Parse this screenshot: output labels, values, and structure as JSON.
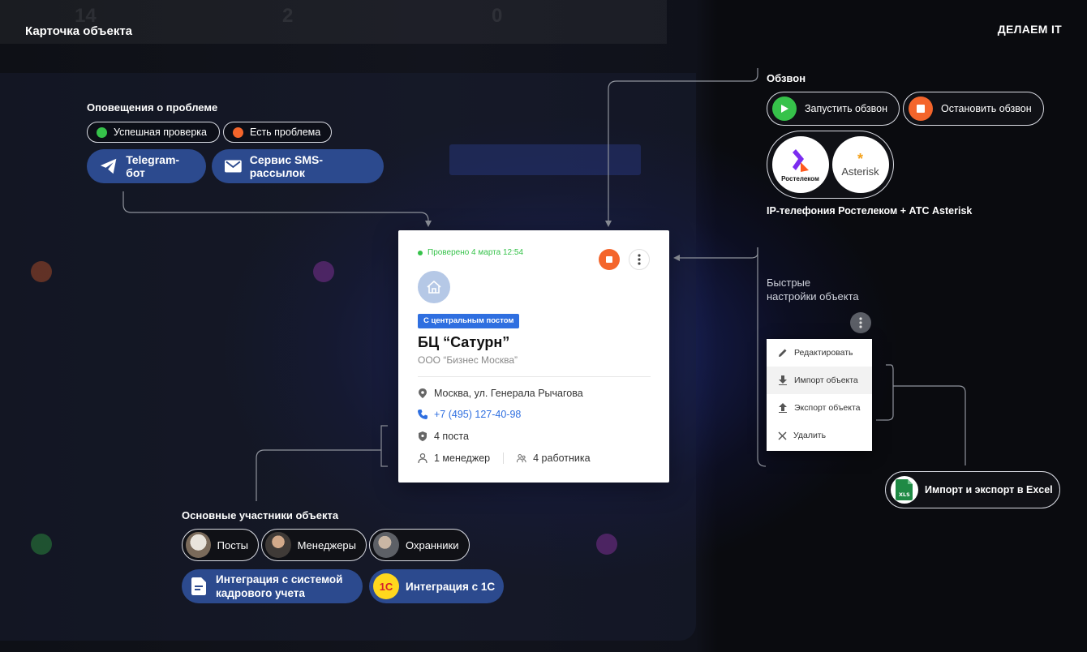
{
  "header": {
    "title": "Карточка объекта",
    "brand": "ДЕЛАЕМ IT"
  },
  "notifications": {
    "label": "Оповещения о проблеме",
    "statuses": [
      {
        "label": "Успешная проверка",
        "color": "#36c24a"
      },
      {
        "label": "Есть проблема",
        "color": "#f4652b"
      }
    ],
    "channels": [
      {
        "label": "Telegram-бот",
        "icon": "telegram-icon"
      },
      {
        "label": "Сервис SMS-рассылок",
        "icon": "mail-icon"
      }
    ]
  },
  "calling": {
    "label": "Обзвон",
    "start": "Запустить обзвон",
    "stop": "Остановить обзвон",
    "logos": [
      "Ростелеком",
      "Asterisk"
    ],
    "caption": "IP-телефония Ростелеком + АТС Asterisk"
  },
  "card": {
    "checked": "Проверено 4 марта 12:54",
    "tag": "С центральным постом",
    "name": "БЦ “Сатурн”",
    "org": "ООО “Бизнес Москва”",
    "address": "Москва, ул. Генерала Рычагова",
    "phone": "+7 (495) 127-40-98",
    "posts": "4 поста",
    "managers": "1 менеджер",
    "workers": "4 работника"
  },
  "quick_settings": {
    "label_line1": "Быстрые",
    "label_line2": "настройки объекта",
    "menu": [
      {
        "label": "Редактировать",
        "icon": "pencil-icon"
      },
      {
        "label": "Импорт объекта",
        "icon": "download-icon"
      },
      {
        "label": "Экспорт объекта",
        "icon": "upload-icon"
      },
      {
        "label": "Удалить",
        "icon": "close-icon"
      }
    ],
    "active_index": 1
  },
  "excel": {
    "label": "Импорт и экспорт в Excel",
    "icon_text": "XLS"
  },
  "participants": {
    "label": "Основные участники объекта",
    "members": [
      {
        "label": "Посты"
      },
      {
        "label": "Менеджеры"
      },
      {
        "label": "Охранники"
      }
    ],
    "integrations": [
      {
        "line1": "Интеграция с системой",
        "line2": "кадрового учета"
      },
      {
        "label": "Интеграция с 1С",
        "badge": "1С"
      }
    ]
  },
  "background": {
    "stats": [
      "14",
      "2",
      "0"
    ]
  },
  "colors": {
    "accent_blue": "#2c4a8e",
    "success": "#36c24a",
    "danger": "#f4652b",
    "link": "#2f6fe0"
  }
}
